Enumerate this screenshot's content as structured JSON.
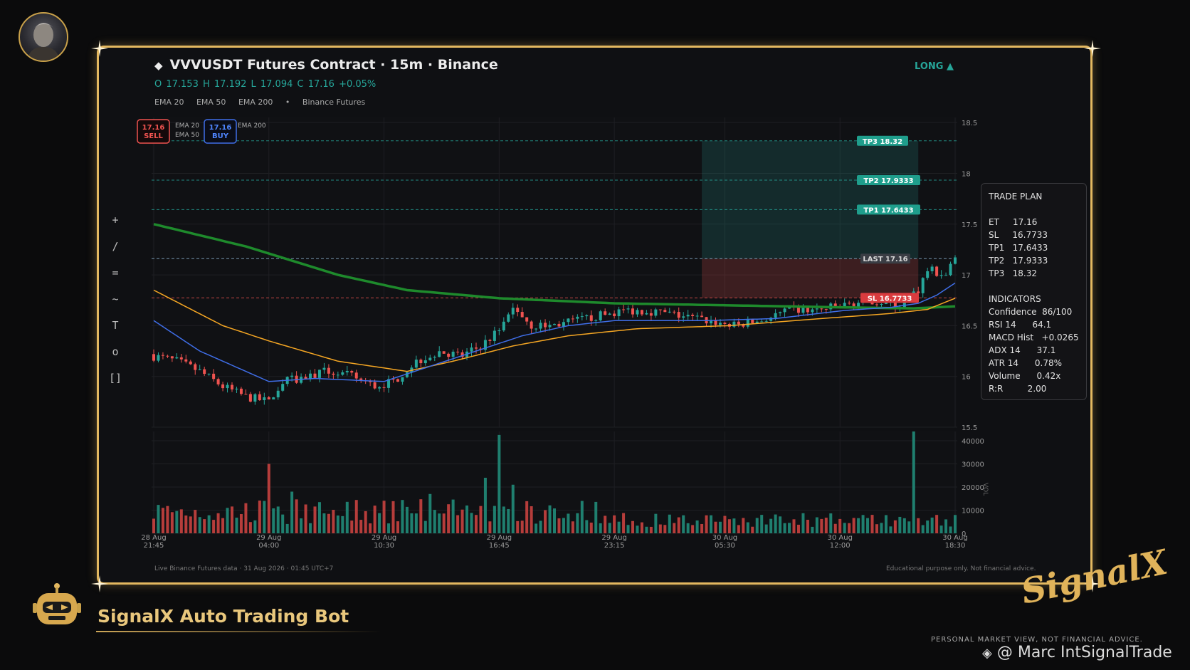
{
  "header": {
    "title": "VVVUSDT Futures Contract  ·  15m  ·  Binance",
    "ohlc": "O 17.153   H 17.192   L 17.094   C 17.16   +0.05%",
    "indicators": [
      "EMA 20",
      "EMA 50",
      "EMA 200",
      "•",
      "Binance Futures"
    ],
    "direction": "LONG ▲"
  },
  "toolbar": [
    "+",
    "/",
    "=",
    "~",
    "T",
    "o",
    "[]"
  ],
  "markers": {
    "sell_price": "17.16",
    "sell_label": "SELL",
    "buy_price": "17.16",
    "buy_label": "BUY",
    "mini_legend": [
      "EMA 20",
      "EMA 50",
      "EMA 200"
    ]
  },
  "levels": {
    "tp3": {
      "label": "TP3  18.32",
      "value": 18.32
    },
    "tp2": {
      "label": "TP2  17.9333",
      "value": 17.9333
    },
    "tp1": {
      "label": "TP1  17.6433",
      "value": 17.6433
    },
    "last": {
      "label": "LAST  17.16",
      "value": 17.16
    },
    "sl": {
      "label": "SL  16.7733",
      "value": 16.7733
    }
  },
  "trade_plan": {
    "title": "TRADE PLAN",
    "rows": [
      "ET     17.16",
      "SL     16.7733",
      "TP1   17.6433",
      "TP2   17.9333",
      "TP3   18.32"
    ],
    "indicators_title": "INDICATORS",
    "indicator_rows": [
      "Confidence  86/100",
      "RSI 14      64.1",
      "MACD Hist   +0.0265",
      "ADX 14      37.1",
      "ATR 14      0.78%",
      "Volume      0.42x",
      "R:R         2.00"
    ]
  },
  "footer": {
    "left": "Live Binance Futures data  ·  31 Aug 2026 · 01:45 UTC+7",
    "right": "Educational purpose only. Not financial advice."
  },
  "branding": {
    "bot_name": "SignalX Auto Trading Bot",
    "logo_text": "SignalX",
    "disclaimer": "PERSONAL MARKET VIEW, NOT FINANCIAL ADVICE.",
    "handle": "@ Marc IntSignalTrade"
  },
  "colors": {
    "up": "#26a69a",
    "down": "#ef5350",
    "ema20": "#3f6ee8",
    "ema50": "#f5a623",
    "ema200": "#1e8a2c",
    "gold": "#e3b860"
  },
  "chart_data": {
    "type": "candlestick",
    "symbol": "VVVUSDT",
    "timeframe": "15m",
    "price_axis": {
      "ticks": [
        15.5,
        16,
        16.5,
        17,
        17.5,
        18,
        18.5
      ],
      "ylim": [
        15.5,
        18.55
      ]
    },
    "volume_axis": {
      "ticks": [
        0,
        10000,
        20000,
        30000,
        40000
      ],
      "ylim": [
        0,
        44000
      ],
      "label": "VOL"
    },
    "x_ticks": [
      {
        "index": 0,
        "label": [
          "28 Aug",
          "21:45"
        ]
      },
      {
        "index": 25,
        "label": [
          "29 Aug",
          "04:00"
        ]
      },
      {
        "index": 50,
        "label": [
          "29 Aug",
          "10:30"
        ]
      },
      {
        "index": 75,
        "label": [
          "29 Aug",
          "16:45"
        ]
      },
      {
        "index": 100,
        "label": [
          "29 Aug",
          "23:15"
        ]
      },
      {
        "index": 124,
        "label": [
          "30 Aug",
          "05:30"
        ]
      },
      {
        "index": 149,
        "label": [
          "30 Aug",
          "12:00"
        ]
      },
      {
        "index": 174,
        "label": [
          "30 Aug",
          "18:30"
        ]
      }
    ],
    "n_candles": 175,
    "close_path": [
      [
        0,
        16.2
      ],
      [
        5,
        16.15
      ],
      [
        10,
        16.05
      ],
      [
        15,
        15.9
      ],
      [
        20,
        15.8
      ],
      [
        25,
        15.75
      ],
      [
        28,
        15.95
      ],
      [
        33,
        16.0
      ],
      [
        38,
        16.05
      ],
      [
        43,
        16.0
      ],
      [
        48,
        15.9
      ],
      [
        52,
        15.95
      ],
      [
        57,
        16.15
      ],
      [
        62,
        16.25
      ],
      [
        67,
        16.2
      ],
      [
        71,
        16.3
      ],
      [
        75,
        16.45
      ],
      [
        78,
        16.7
      ],
      [
        82,
        16.5
      ],
      [
        86,
        16.5
      ],
      [
        92,
        16.55
      ],
      [
        97,
        16.6
      ],
      [
        102,
        16.65
      ],
      [
        107,
        16.65
      ],
      [
        114,
        16.6
      ],
      [
        120,
        16.55
      ],
      [
        126,
        16.5
      ],
      [
        132,
        16.55
      ],
      [
        138,
        16.65
      ],
      [
        144,
        16.65
      ],
      [
        150,
        16.7
      ],
      [
        156,
        16.75
      ],
      [
        162,
        16.7
      ],
      [
        166,
        16.85
      ],
      [
        168,
        17.05
      ],
      [
        172,
        17.0
      ],
      [
        174,
        17.16
      ]
    ],
    "ema20_path": [
      [
        0,
        16.55
      ],
      [
        10,
        16.25
      ],
      [
        20,
        16.05
      ],
      [
        25,
        15.95
      ],
      [
        35,
        15.98
      ],
      [
        50,
        15.95
      ],
      [
        60,
        16.1
      ],
      [
        70,
        16.25
      ],
      [
        80,
        16.4
      ],
      [
        90,
        16.5
      ],
      [
        100,
        16.55
      ],
      [
        120,
        16.55
      ],
      [
        135,
        16.57
      ],
      [
        150,
        16.65
      ],
      [
        160,
        16.68
      ],
      [
        166,
        16.72
      ],
      [
        170,
        16.8
      ],
      [
        174,
        16.92
      ]
    ],
    "ema50_path": [
      [
        0,
        16.85
      ],
      [
        15,
        16.5
      ],
      [
        25,
        16.35
      ],
      [
        40,
        16.15
      ],
      [
        55,
        16.05
      ],
      [
        65,
        16.15
      ],
      [
        78,
        16.3
      ],
      [
        90,
        16.4
      ],
      [
        105,
        16.47
      ],
      [
        125,
        16.5
      ],
      [
        145,
        16.57
      ],
      [
        160,
        16.62
      ],
      [
        168,
        16.66
      ],
      [
        174,
        16.77
      ]
    ],
    "ema200_path": [
      [
        0,
        17.5
      ],
      [
        20,
        17.28
      ],
      [
        40,
        17.0
      ],
      [
        55,
        16.85
      ],
      [
        75,
        16.77
      ],
      [
        100,
        16.72
      ],
      [
        125,
        16.7
      ],
      [
        150,
        16.68
      ],
      [
        165,
        16.67
      ],
      [
        174,
        16.69
      ]
    ],
    "volume_spikes": [
      [
        25,
        30000
      ],
      [
        30,
        18000
      ],
      [
        60,
        17000
      ],
      [
        72,
        24000
      ],
      [
        75,
        42500
      ],
      [
        78,
        21000
      ],
      [
        165,
        44000
      ]
    ],
    "target_zone": {
      "start_index": 119,
      "end_index": 166,
      "from": 17.16,
      "to": 18.32
    },
    "stop_zone": {
      "start_index": 119,
      "end_index": 166,
      "from": 16.7733,
      "to": 17.16
    }
  }
}
